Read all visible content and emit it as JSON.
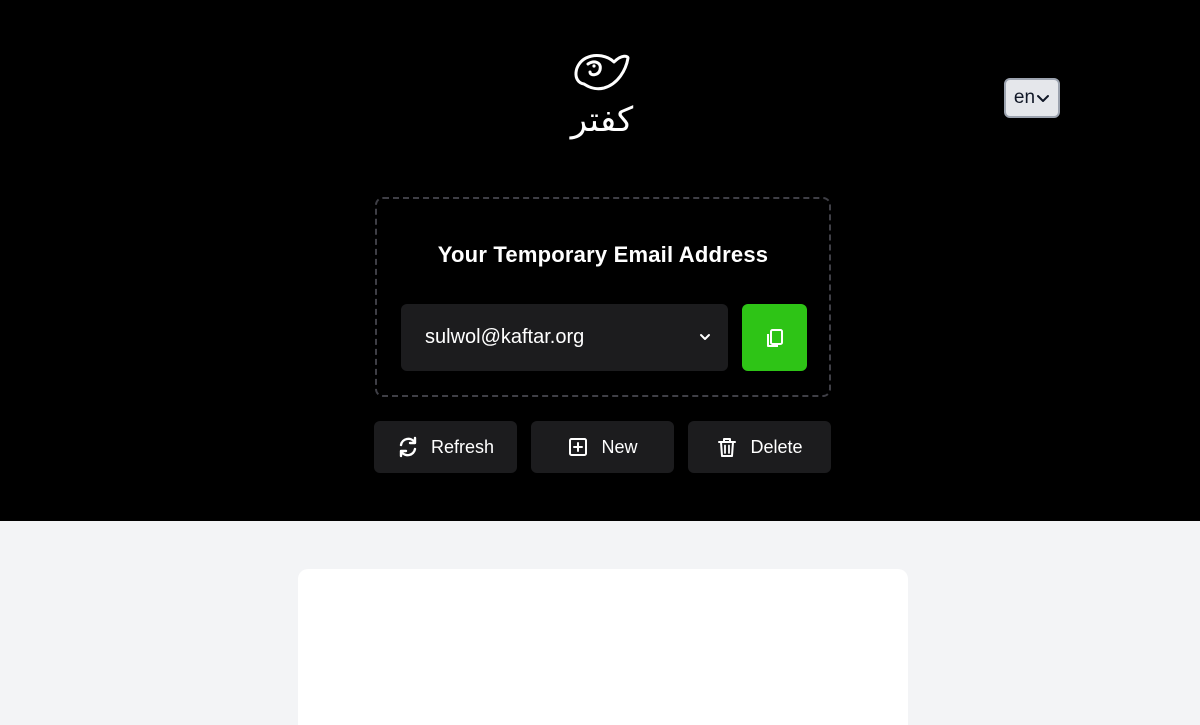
{
  "header": {
    "logo_text": "کفتر",
    "language": "en"
  },
  "email_panel": {
    "title": "Your Temporary Email Address",
    "selected_address": "sulwol@kaftar.org",
    "copy_button_color": "#2ec416"
  },
  "actions": {
    "refresh_label": "Refresh",
    "new_label": "New",
    "delete_label": "Delete"
  },
  "icons": {
    "logo": "dove-logo-icon",
    "language_chevron": "chevron-down-icon",
    "email_chevron": "chevron-down-icon",
    "copy": "copy-icon",
    "refresh": "refresh-icon",
    "new": "plus-square-icon",
    "delete": "trash-icon"
  },
  "colors": {
    "hero_background": "#000000",
    "page_background": "#f3f4f6",
    "button_background": "#1c1c1e"
  }
}
